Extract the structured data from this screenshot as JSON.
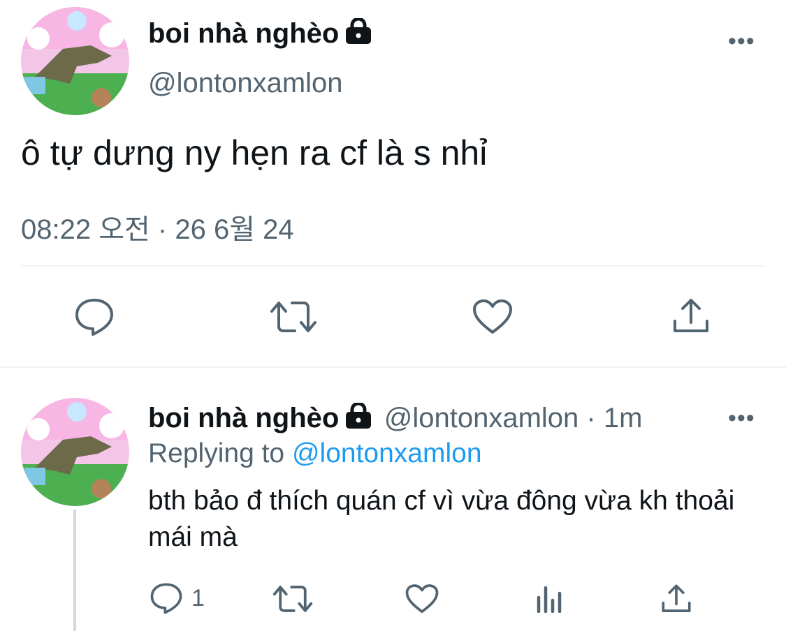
{
  "main_tweet": {
    "display_name": "boi nhà nghèo",
    "handle": "@lontonxamlon",
    "more": "•••",
    "text": "ô tự dưng ny hẹn ra cf là s nhỉ",
    "timestamp": "08:22 오전 · 26 6월 24",
    "actions": [
      "reply-icon",
      "retweet-icon",
      "like-icon",
      "share-icon"
    ]
  },
  "reply_tweet": {
    "display_name": "boi nhà nghèo",
    "handle": "@lontonxamlon",
    "time_sep": " · ",
    "time": "1m",
    "more": "•••",
    "replying_prefix": "Replying to ",
    "replying_handle": "@lontonxamlon",
    "text": "bth bảo đ thích quán cf vì vừa đông vừa kh thoải mái mà",
    "reply_count": "1",
    "actions": [
      "reply-icon",
      "retweet-icon",
      "like-icon",
      "views-icon",
      "share-icon"
    ]
  },
  "colors": {
    "text_primary": "#0f1419",
    "text_secondary": "#536471",
    "link": "#1d9bf0",
    "divider": "#eff3f4"
  }
}
